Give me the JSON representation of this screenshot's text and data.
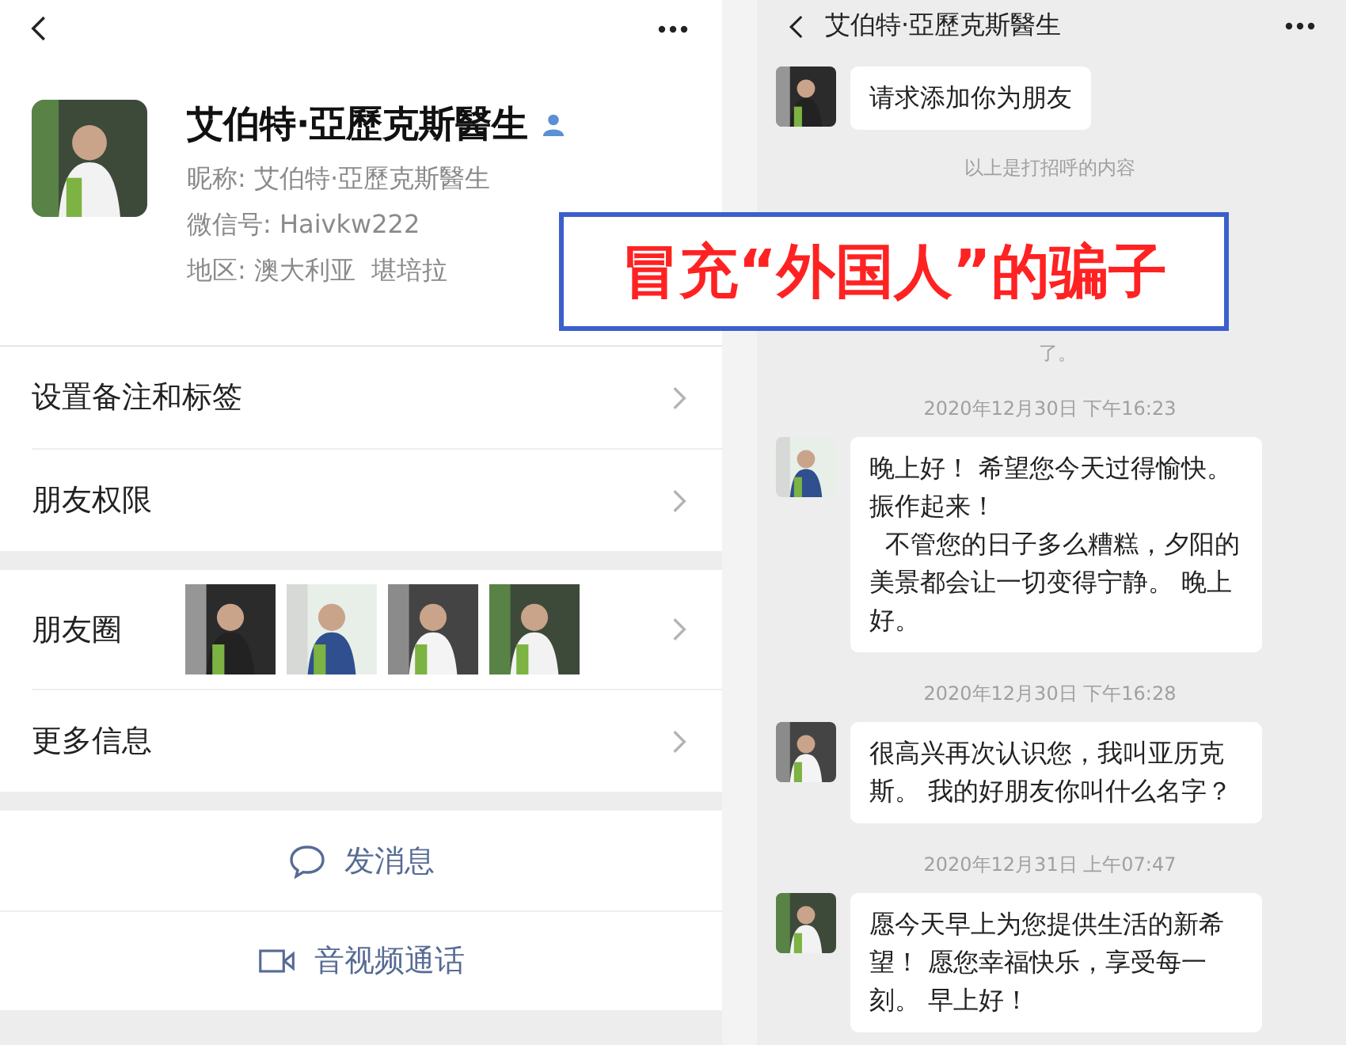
{
  "profile_screen": {
    "profile": {
      "name": "艾伯特·亞歷克斯醫生",
      "info_lines": [
        "昵称: 艾伯特·亞歷克斯醫生",
        "微信号: Haivkw222",
        "地区: 澳大利亚  堪培拉"
      ]
    },
    "menu_groups": [
      [
        {
          "label": "设置备注和标签",
          "kind": "plain"
        },
        {
          "label": "朋友权限",
          "kind": "plain"
        }
      ],
      [
        {
          "label": "朋友圈",
          "kind": "photos"
        },
        {
          "label": "更多信息",
          "kind": "plain"
        }
      ]
    ],
    "actions": [
      {
        "label": "发消息",
        "kind": "message"
      },
      {
        "label": "音视频通话",
        "kind": "video"
      }
    ]
  },
  "chat_screen": {
    "title": "艾伯特·亞歷克斯醫生",
    "messages": [
      {
        "kind": "bubble",
        "paragraphs": [
          "请求添加你为朋友"
        ]
      },
      {
        "kind": "notice",
        "text": "以上是打招呼的内容"
      },
      {
        "kind": "notice_tail",
        "text": "了。"
      },
      {
        "kind": "time",
        "text": "2020年12月30日 下午16:23"
      },
      {
        "kind": "bubble",
        "paragraphs": [
          "晚上好！ 希望您今天过得愉快。振作起来！",
          "  不管您的日子多么糟糕，夕阳的美景都会让一切变得宁静。 晚上好。"
        ]
      },
      {
        "kind": "time",
        "text": "2020年12月30日 下午16:28"
      },
      {
        "kind": "bubble",
        "paragraphs": [
          "很高兴再次认识您，我叫亚历克斯。 我的好朋友你叫什么名字？"
        ]
      },
      {
        "kind": "time",
        "text": "2020年12月31日 上午07:47"
      },
      {
        "kind": "bubble",
        "paragraphs": [
          "愿今天早上为您提供生活的新希望！ 愿您幸福快乐，享受每一刻。 早上好！"
        ]
      }
    ]
  },
  "overlay_caption": "冒充“外国人”的骗子"
}
